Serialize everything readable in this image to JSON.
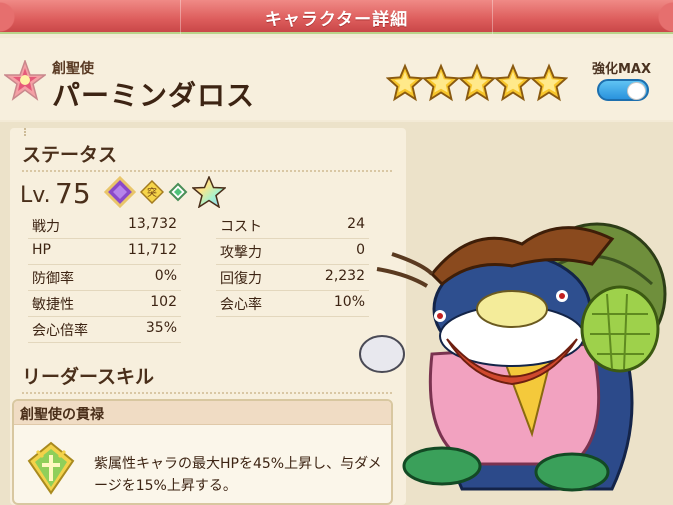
{
  "header": {
    "title": "キャラクター詳細"
  },
  "character": {
    "rank": "創聖使",
    "name": "パーミンダロス",
    "star_count": 5,
    "enhance_label": "強化MAX",
    "enhance_on": true
  },
  "status": {
    "section_title": "ステータス",
    "level_prefix": "Lv.",
    "level": "75",
    "badge_text": "突",
    "left_stats": [
      {
        "label": "戦力",
        "value": "13,732"
      },
      {
        "label": "HP",
        "value": "11,712"
      },
      {
        "label": "防御率",
        "value": "0%"
      },
      {
        "label": "敏捷性",
        "value": "102"
      },
      {
        "label": "会心倍率",
        "value": "35%"
      }
    ],
    "right_stats": [
      {
        "label": "コスト",
        "value": "24"
      },
      {
        "label": "攻撃力",
        "value": "0"
      },
      {
        "label": "回復力",
        "value": "2,232"
      },
      {
        "label": "会心率",
        "value": "10%"
      }
    ]
  },
  "leader_skill": {
    "section_title": "リーダースキル",
    "name": "創聖使の貫禄",
    "description": "紫属性キャラの最大HPを45%上昇し、与ダメージを15%上昇する。"
  },
  "colors": {
    "header": "#dd5d5c",
    "accent_green": "#b9d38a",
    "toggle_blue": "#2a93dd",
    "star_gold": "#f7c52b"
  }
}
